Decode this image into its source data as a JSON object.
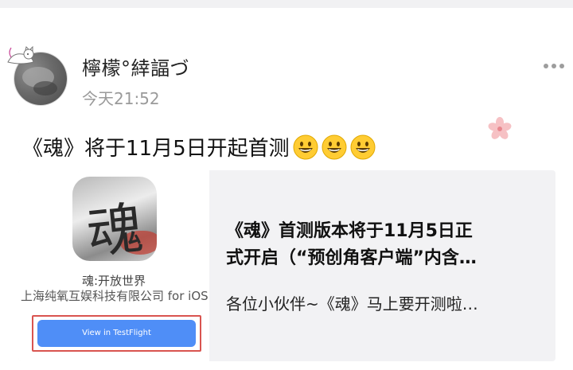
{
  "post": {
    "username": "檸檬°緈諨づ",
    "timestamp": "今天21:52",
    "text": "《魂》将于11月5日开起首测",
    "emojis": [
      "grinning-face-icon",
      "grinning-face-icon",
      "grinning-face-icon"
    ]
  },
  "card": {
    "app_name": "魂:开放世界",
    "developer": "上海纯氧互娱科技有限公司 for iOS",
    "button_label": "View in TestFlight",
    "title_line1": "《魂》首测版本将于11月5日正",
    "title_line2": "式开启（“预创角客户端”内含…",
    "description": "各位小伙伴~《魂》马上要开测啦…",
    "icon_glyph": "魂"
  },
  "colors": {
    "accent_button": "#4f8ef7",
    "highlight_border": "#d9544f",
    "card_bg": "#f2f2f4",
    "timestamp": "#9a9a9a"
  }
}
